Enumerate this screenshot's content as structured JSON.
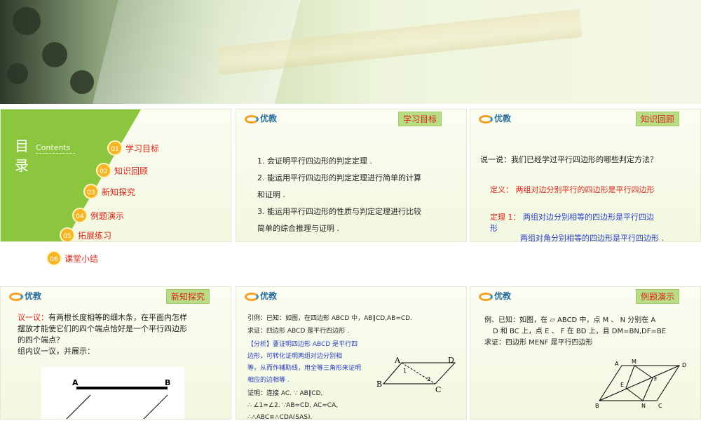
{
  "slide1": {
    "title": "目录",
    "contents_label": "Contents",
    "toc": [
      {
        "num": "01",
        "label": "学习目标"
      },
      {
        "num": "02",
        "label": "知识回顾"
      },
      {
        "num": "03",
        "label": "新知探究"
      },
      {
        "num": "04",
        "label": "例题演示"
      },
      {
        "num": "05",
        "label": "拓展练习"
      },
      {
        "num": "06",
        "label": "课堂小结"
      }
    ]
  },
  "logo_text": "优教",
  "slide2": {
    "tag": "学习目标",
    "lines": [
      "1. 会证明平行四边形的判定定理 .",
      "2. 能运用平行四边形的判定定理进行简单的计算",
      "和证明 .",
      "3. 能运用平行四边形的性质与判定定理进行比较",
      "简单的综合推理与证明 ."
    ]
  },
  "slide3": {
    "tag": "知识回顾",
    "question": "说一说：我们已经学过平行四边形的哪些判定方法？",
    "def_label": "定义：",
    "def_text": "两组对边分别平行的四边形是平行四边形",
    "thm_label": "定理 1：",
    "thm_text1": "两组对边分别相等的四边形是平行四边",
    "thm_text1b": "形",
    "thm_text2": "两组对角分别相等的四边形是平行四边形 ."
  },
  "slide4": {
    "tag": "新知探究",
    "discuss_label": "议一议：",
    "discuss_text": "有两根长度相等的细木条，在平面内怎样",
    "discuss_text2": "摆放才能使它们的四个端点恰好是一个平行四边形",
    "discuss_text3": "的四个端点？",
    "group_text": "组内议一议，并展示：",
    "pt_a": "A",
    "pt_b": "B"
  },
  "slide5": {
    "lines": [
      "引例：已知：如图，在四边形 ABCD 中，AB∥CD,AB=CD.",
      "求证：四边形 ABCD 是平行四边形 ."
    ],
    "analysis": [
      "【分析】要证明四边形 ABCD 是平行四",
      "边形，可转化证明两组对边分别相",
      "等，从而作辅助线，用全等三角形来证明",
      "相应的边相等 ."
    ],
    "proof": [
      "证明：连接 AC.  ∵ AB∥CD,",
      "∴ ∠1=∠2. ∵AB=CD, AC=CA,",
      "∴△ABC≌△CDA(SAS)."
    ],
    "fig": {
      "a": "A",
      "b": "B",
      "c": "C",
      "d": "D",
      "n1": "1",
      "n2": "2"
    }
  },
  "slide6": {
    "tag": "例题演示",
    "line1": "例、已知：如图，在 ▱ ABCD 中，点 M 、 N 分别在 A",
    "line2": "D 和 BC 上，点 E 、 F 在 BD 上，且 DM=BN,DF=BE",
    "line3": "求证：四边形 MENF 是平行四边形",
    "fig": {
      "a": "A",
      "m": "M",
      "d": "D",
      "e": "E",
      "f": "F",
      "b": "B",
      "n": "N",
      "c": "C"
    }
  }
}
